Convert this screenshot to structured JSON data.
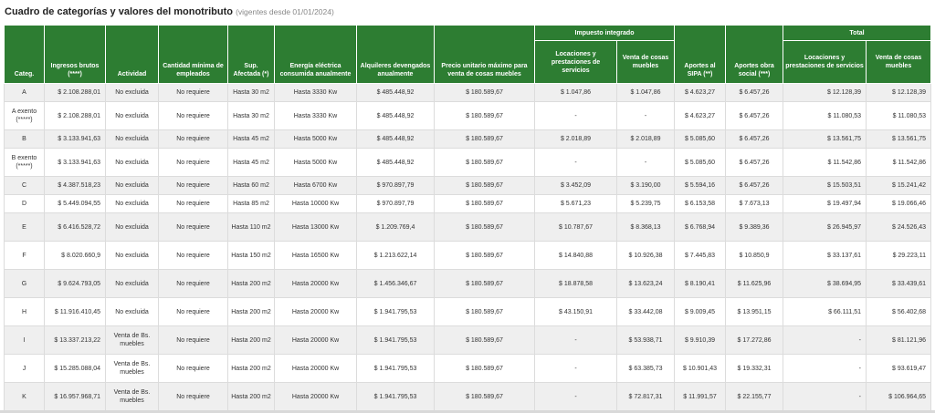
{
  "title": {
    "main": "Cuadro de categorías y valores del monotributo",
    "sub": "(vigentes desde 01/01/2024)"
  },
  "headers": {
    "group_impuesto": "Impuesto integrado",
    "group_total": "Total",
    "cols": [
      "Categ.",
      "Ingresos brutos (****)",
      "Actividad",
      "Cantidad mínima de empleados",
      "Sup. Afectada (*)",
      "Energía eléctrica consumida anualmente",
      "Alquileres devengados anualmente",
      "Precio unitario máximo para venta de cosas muebles",
      "Locaciones y prestaciones de servicios",
      "Venta de cosas muebles",
      "Aportes al SIPA (**)",
      "Aportes obra social (***)",
      "Locaciones y prestaciones de servicios",
      "Venta de cosas muebles"
    ]
  },
  "rows": [
    [
      "A",
      "$ 2.108.288,01",
      "No excluida",
      "No requiere",
      "Hasta 30 m2",
      "Hasta 3330 Kw",
      "$ 485.448,92",
      "$ 180.589,67",
      "$ 1.047,86",
      "$ 1.047,86",
      "$ 4.623,27",
      "$ 6.457,26",
      "$ 12.128,39",
      "$ 12.128,39"
    ],
    [
      "A exento (*****)",
      "$ 2.108.288,01",
      "No excluida",
      "No requiere",
      "Hasta 30 m2",
      "Hasta 3330 Kw",
      "$ 485.448,92",
      "$ 180.589,67",
      "-",
      "-",
      "$ 4.623,27",
      "$ 6.457,26",
      "$ 11.080,53",
      "$ 11.080,53"
    ],
    [
      "B",
      "$ 3.133.941,63",
      "No excluida",
      "No requiere",
      "Hasta 45 m2",
      "Hasta 5000 Kw",
      "$ 485.448,92",
      "$ 180.589,67",
      "$ 2.018,89",
      "$ 2.018,89",
      "$ 5.085,60",
      "$ 6.457,26",
      "$ 13.561,75",
      "$ 13.561,75"
    ],
    [
      "B exento (*****)",
      "$ 3.133.941,63",
      "No excluida",
      "No requiere",
      "Hasta 45 m2",
      "Hasta 5000 Kw",
      "$ 485.448,92",
      "$ 180.589,67",
      "-",
      "-",
      "$ 5.085,60",
      "$ 6.457,26",
      "$ 11.542,86",
      "$ 11.542,86"
    ],
    [
      "C",
      "$ 4.387.518,23",
      "No excluida",
      "No requiere",
      "Hasta 60 m2",
      "Hasta 6700 Kw",
      "$ 970.897,79",
      "$ 180.589,67",
      "$ 3.452,09",
      "$ 3.190,00",
      "$ 5.594,16",
      "$ 6.457,26",
      "$ 15.503,51",
      "$ 15.241,42"
    ],
    [
      "D",
      "$ 5.449.094,55",
      "No excluida",
      "No requiere",
      "Hasta 85 m2",
      "Hasta 10000 Kw",
      "$ 970.897,79",
      "$ 180.589,67",
      "$ 5.671,23",
      "$ 5.239,75",
      "$ 6.153,58",
      "$ 7.673,13",
      "$ 19.497,94",
      "$ 19.066,46"
    ],
    [
      "E",
      "$ 6.416.528,72",
      "No excluida",
      "No requiere",
      "Hasta 110 m2",
      "Hasta 13000 Kw",
      "$ 1.209.769,4",
      "$ 180.589,67",
      "$ 10.787,67",
      "$ 8.368,13",
      "$ 6.768,94",
      "$ 9.389,36",
      "$ 26.945,97",
      "$ 24.526,43"
    ],
    [
      "F",
      "$ 8.020.660,9",
      "No excluida",
      "No requiere",
      "Hasta 150 m2",
      "Hasta 16500 Kw",
      "$ 1.213.622,14",
      "$ 180.589,67",
      "$ 14.840,88",
      "$ 10.926,38",
      "$ 7.445,83",
      "$ 10.850,9",
      "$ 33.137,61",
      "$ 29.223,11"
    ],
    [
      "G",
      "$ 9.624.793,05",
      "No excluida",
      "No requiere",
      "Hasta 200 m2",
      "Hasta 20000 Kw",
      "$ 1.456.346,67",
      "$ 180.589,67",
      "$ 18.878,58",
      "$ 13.623,24",
      "$ 8.190,41",
      "$ 11.625,96",
      "$ 38.694,95",
      "$ 33.439,61"
    ],
    [
      "H",
      "$ 11.916.410,45",
      "No excluida",
      "No requiere",
      "Hasta 200 m2",
      "Hasta 20000 Kw",
      "$ 1.941.795,53",
      "$ 180.589,67",
      "$ 43.150,91",
      "$ 33.442,08",
      "$ 9.009,45",
      "$ 13.951,15",
      "$ 66.111,51",
      "$ 56.402,68"
    ],
    [
      "I",
      "$ 13.337.213,22",
      "Venta de Bs. muebles",
      "No requiere",
      "Hasta 200 m2",
      "Hasta 20000 Kw",
      "$ 1.941.795,53",
      "$ 180.589,67",
      "-",
      "$ 53.938,71",
      "$ 9.910,39",
      "$ 17.272,86",
      "-",
      "$ 81.121,96"
    ],
    [
      "J",
      "$ 15.285.088,04",
      "Venta de Bs. muebles",
      "No requiere",
      "Hasta 200 m2",
      "Hasta 20000 Kw",
      "$ 1.941.795,53",
      "$ 180.589,67",
      "-",
      "$ 63.385,73",
      "$ 10.901,43",
      "$ 19.332,31",
      "-",
      "$ 93.619,47"
    ],
    [
      "K",
      "$ 16.957.968,71",
      "Venta de Bs. muebles",
      "No requiere",
      "Hasta 200 m2",
      "Hasta 20000 Kw",
      "$ 1.941.795,53",
      "$ 180.589,67",
      "-",
      "$ 72.817,31",
      "$ 11.991,57",
      "$ 22.155,77",
      "-",
      "$ 106.964,65"
    ]
  ]
}
